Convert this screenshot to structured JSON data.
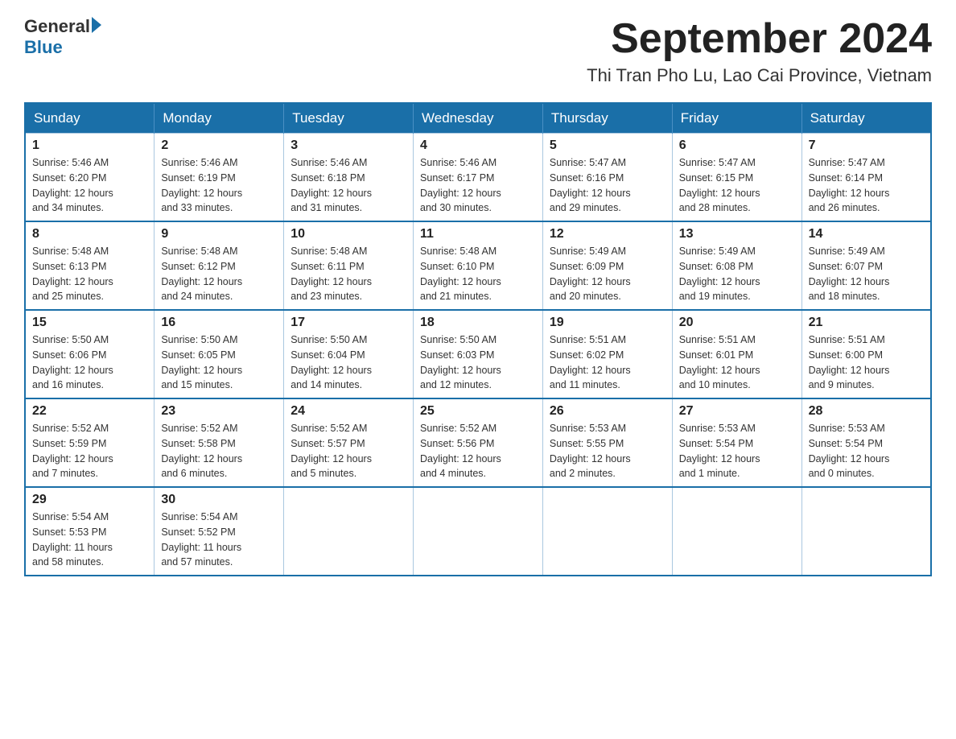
{
  "logo": {
    "general": "General",
    "blue": "Blue"
  },
  "title": "September 2024",
  "subtitle": "Thi Tran Pho Lu, Lao Cai Province, Vietnam",
  "days_of_week": [
    "Sunday",
    "Monday",
    "Tuesday",
    "Wednesday",
    "Thursday",
    "Friday",
    "Saturday"
  ],
  "weeks": [
    [
      {
        "day": "1",
        "sunrise": "5:46 AM",
        "sunset": "6:20 PM",
        "daylight": "12 hours and 34 minutes."
      },
      {
        "day": "2",
        "sunrise": "5:46 AM",
        "sunset": "6:19 PM",
        "daylight": "12 hours and 33 minutes."
      },
      {
        "day": "3",
        "sunrise": "5:46 AM",
        "sunset": "6:18 PM",
        "daylight": "12 hours and 31 minutes."
      },
      {
        "day": "4",
        "sunrise": "5:46 AM",
        "sunset": "6:17 PM",
        "daylight": "12 hours and 30 minutes."
      },
      {
        "day": "5",
        "sunrise": "5:47 AM",
        "sunset": "6:16 PM",
        "daylight": "12 hours and 29 minutes."
      },
      {
        "day": "6",
        "sunrise": "5:47 AM",
        "sunset": "6:15 PM",
        "daylight": "12 hours and 28 minutes."
      },
      {
        "day": "7",
        "sunrise": "5:47 AM",
        "sunset": "6:14 PM",
        "daylight": "12 hours and 26 minutes."
      }
    ],
    [
      {
        "day": "8",
        "sunrise": "5:48 AM",
        "sunset": "6:13 PM",
        "daylight": "12 hours and 25 minutes."
      },
      {
        "day": "9",
        "sunrise": "5:48 AM",
        "sunset": "6:12 PM",
        "daylight": "12 hours and 24 minutes."
      },
      {
        "day": "10",
        "sunrise": "5:48 AM",
        "sunset": "6:11 PM",
        "daylight": "12 hours and 23 minutes."
      },
      {
        "day": "11",
        "sunrise": "5:48 AM",
        "sunset": "6:10 PM",
        "daylight": "12 hours and 21 minutes."
      },
      {
        "day": "12",
        "sunrise": "5:49 AM",
        "sunset": "6:09 PM",
        "daylight": "12 hours and 20 minutes."
      },
      {
        "day": "13",
        "sunrise": "5:49 AM",
        "sunset": "6:08 PM",
        "daylight": "12 hours and 19 minutes."
      },
      {
        "day": "14",
        "sunrise": "5:49 AM",
        "sunset": "6:07 PM",
        "daylight": "12 hours and 18 minutes."
      }
    ],
    [
      {
        "day": "15",
        "sunrise": "5:50 AM",
        "sunset": "6:06 PM",
        "daylight": "12 hours and 16 minutes."
      },
      {
        "day": "16",
        "sunrise": "5:50 AM",
        "sunset": "6:05 PM",
        "daylight": "12 hours and 15 minutes."
      },
      {
        "day": "17",
        "sunrise": "5:50 AM",
        "sunset": "6:04 PM",
        "daylight": "12 hours and 14 minutes."
      },
      {
        "day": "18",
        "sunrise": "5:50 AM",
        "sunset": "6:03 PM",
        "daylight": "12 hours and 12 minutes."
      },
      {
        "day": "19",
        "sunrise": "5:51 AM",
        "sunset": "6:02 PM",
        "daylight": "12 hours and 11 minutes."
      },
      {
        "day": "20",
        "sunrise": "5:51 AM",
        "sunset": "6:01 PM",
        "daylight": "12 hours and 10 minutes."
      },
      {
        "day": "21",
        "sunrise": "5:51 AM",
        "sunset": "6:00 PM",
        "daylight": "12 hours and 9 minutes."
      }
    ],
    [
      {
        "day": "22",
        "sunrise": "5:52 AM",
        "sunset": "5:59 PM",
        "daylight": "12 hours and 7 minutes."
      },
      {
        "day": "23",
        "sunrise": "5:52 AM",
        "sunset": "5:58 PM",
        "daylight": "12 hours and 6 minutes."
      },
      {
        "day": "24",
        "sunrise": "5:52 AM",
        "sunset": "5:57 PM",
        "daylight": "12 hours and 5 minutes."
      },
      {
        "day": "25",
        "sunrise": "5:52 AM",
        "sunset": "5:56 PM",
        "daylight": "12 hours and 4 minutes."
      },
      {
        "day": "26",
        "sunrise": "5:53 AM",
        "sunset": "5:55 PM",
        "daylight": "12 hours and 2 minutes."
      },
      {
        "day": "27",
        "sunrise": "5:53 AM",
        "sunset": "5:54 PM",
        "daylight": "12 hours and 1 minute."
      },
      {
        "day": "28",
        "sunrise": "5:53 AM",
        "sunset": "5:54 PM",
        "daylight": "12 hours and 0 minutes."
      }
    ],
    [
      {
        "day": "29",
        "sunrise": "5:54 AM",
        "sunset": "5:53 PM",
        "daylight": "11 hours and 58 minutes."
      },
      {
        "day": "30",
        "sunrise": "5:54 AM",
        "sunset": "5:52 PM",
        "daylight": "11 hours and 57 minutes."
      },
      null,
      null,
      null,
      null,
      null
    ]
  ],
  "labels": {
    "sunrise": "Sunrise:",
    "sunset": "Sunset:",
    "daylight": "Daylight:"
  }
}
